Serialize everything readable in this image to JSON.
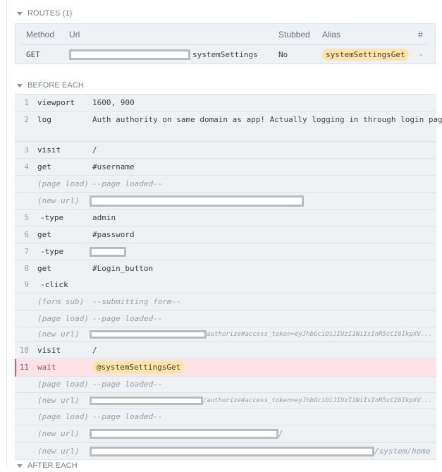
{
  "routes": {
    "header": "ROUTES (1)",
    "columns": {
      "method": "Method",
      "url": "Url",
      "stubbed": "Stubbed",
      "alias": "Alias",
      "count": "#"
    },
    "row": {
      "method": "GET",
      "url_suffix": "systemSettings",
      "stubbed": "No",
      "alias": "systemSettingsGet",
      "count": "-"
    }
  },
  "before_each": {
    "header": "BEFORE EACH",
    "commands": [
      {
        "num": "1",
        "name": "viewport",
        "message": "1600, 900"
      },
      {
        "num": "2",
        "name": "log",
        "message": "Auth authority on same domain as app! Actually logging in through login page..."
      },
      {
        "num": "3",
        "name": "visit",
        "message": "/"
      },
      {
        "num": "4",
        "name": "get",
        "message": "#username"
      },
      {
        "num": "",
        "name": "(page load)",
        "message": "--page loaded--"
      },
      {
        "num": "",
        "name": "(new url)",
        "message": ""
      },
      {
        "num": "5",
        "name": "-type",
        "message": "admin"
      },
      {
        "num": "6",
        "name": "get",
        "message": "#password"
      },
      {
        "num": "7",
        "name": "-type",
        "message": ""
      },
      {
        "num": "8",
        "name": "get",
        "message": "#Login_button"
      },
      {
        "num": "9",
        "name": "-click",
        "message": ""
      },
      {
        "num": "",
        "name": "(form sub)",
        "message": "--submitting form--"
      },
      {
        "num": "",
        "name": "(page load)",
        "message": "--page loaded--"
      },
      {
        "num": "",
        "name": "(new url)",
        "message": "authorize#access_token=eyJhbGciOiJIUzI1NiIsInR5cCI6IkpXV..."
      },
      {
        "num": "10",
        "name": "visit",
        "message": "/"
      },
      {
        "num": "11",
        "name": "wait",
        "message": "@systemSettingsGet"
      },
      {
        "num": "",
        "name": "(page load)",
        "message": "--page loaded--"
      },
      {
        "num": "",
        "name": "(new url)",
        "message": "/authorize#access_token=eyJhbGciOiJIUzI1NiIsInR5cCI6IkpXV..."
      },
      {
        "num": "",
        "name": "(page load)",
        "message": "--page loaded--"
      },
      {
        "num": "",
        "name": "(new url)",
        "message": "/"
      },
      {
        "num": "",
        "name": "(new url)",
        "message": "/system/home"
      }
    ]
  },
  "after_each": {
    "header": "AFTER EACH"
  }
}
